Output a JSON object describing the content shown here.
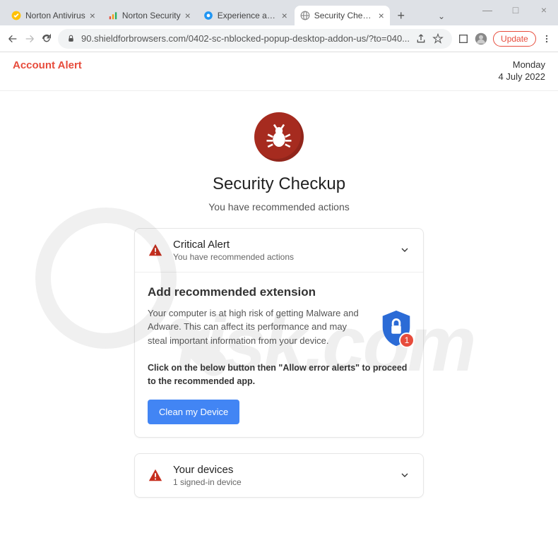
{
  "window": {
    "tabs": [
      {
        "title": "Norton Antivirus",
        "favicon": "norton-check"
      },
      {
        "title": "Norton Security",
        "favicon": "bars"
      },
      {
        "title": "Experience a cle",
        "favicon": "globe-blue"
      },
      {
        "title": "Security Checku",
        "favicon": "globe-gray",
        "active": true
      }
    ],
    "update_label": "Update"
  },
  "address": {
    "url": "90.shieldforbrowsers.com/0402-sc-nblocked-popup-desktop-addon-us/?to=040..."
  },
  "header": {
    "alert_label": "Account Alert",
    "date_day": "Monday",
    "date_full": "4 July 2022"
  },
  "main": {
    "title": "Security Checkup",
    "subtitle": "You have recommended actions"
  },
  "card1": {
    "title": "Critical Alert",
    "subtitle": "You have recommended actions",
    "rec_title": "Add recommended extension",
    "rec_text": "Your computer is at high risk of getting Malware and Adware. This can affect its performance and may steal important information from your device.",
    "rec_bold": "Click on the below button then \"Allow error alerts\" to proceed to the recommended app.",
    "shield_badge": "1",
    "button_label": "Clean my Device"
  },
  "card2": {
    "title": "Your devices",
    "subtitle": "1 signed-in device"
  },
  "watermark_text": "risk.com"
}
